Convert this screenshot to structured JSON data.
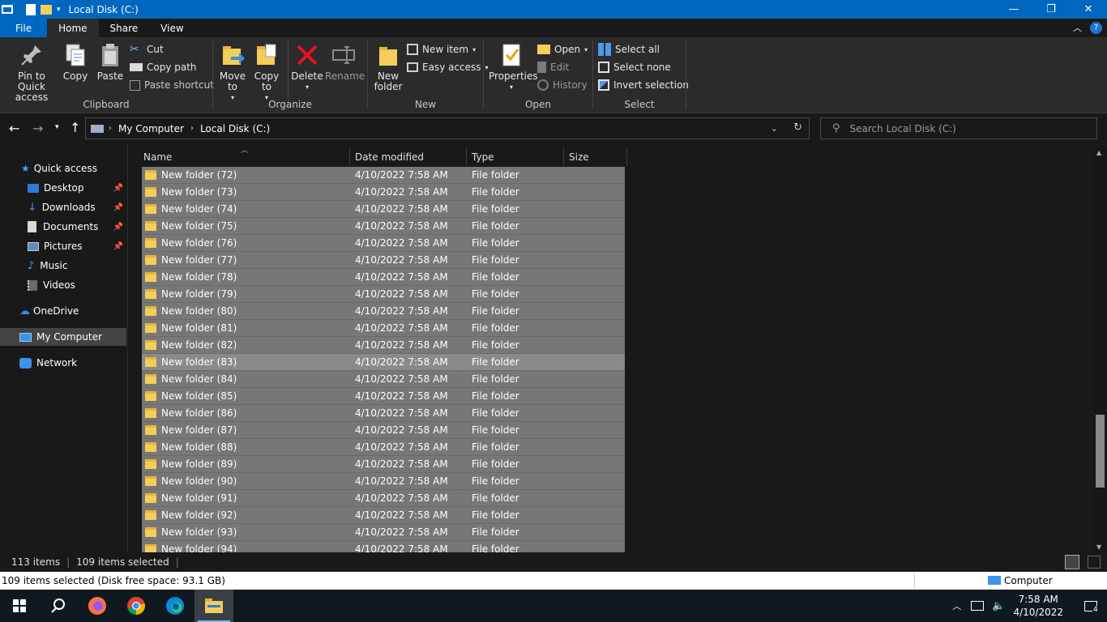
{
  "window": {
    "title": "Local Disk (C:)"
  },
  "tabs": {
    "file": "File",
    "home": "Home",
    "share": "Share",
    "view": "View"
  },
  "ribbon": {
    "clipboard": {
      "label": "Clipboard",
      "pin": "Pin to Quick access",
      "copy": "Copy",
      "paste": "Paste",
      "cut": "Cut",
      "copy_path": "Copy path",
      "paste_shortcut": "Paste shortcut"
    },
    "organize": {
      "label": "Organize",
      "move_to": "Move to",
      "copy_to": "Copy to",
      "delete": "Delete",
      "rename": "Rename"
    },
    "new": {
      "label": "New",
      "new_folder": "New folder",
      "new_item": "New item",
      "easy_access": "Easy access"
    },
    "open": {
      "label": "Open",
      "properties": "Properties",
      "open": "Open",
      "edit": "Edit",
      "history": "History"
    },
    "select": {
      "label": "Select",
      "select_all": "Select all",
      "select_none": "Select none",
      "invert": "Invert selection"
    }
  },
  "address": {
    "crumbs": [
      "My Computer",
      "Local Disk (C:)"
    ],
    "search_placeholder": "Search Local Disk (C:)"
  },
  "nav": {
    "quick_access": "Quick access",
    "desktop": "Desktop",
    "downloads": "Downloads",
    "documents": "Documents",
    "pictures": "Pictures",
    "music": "Music",
    "videos": "Videos",
    "onedrive": "OneDrive",
    "my_computer": "My Computer",
    "network": "Network"
  },
  "columns": {
    "name": "Name",
    "date": "Date modified",
    "type": "Type",
    "size": "Size"
  },
  "rows": [
    {
      "name": "New folder (72)",
      "date": "4/10/2022 7:58 AM",
      "type": "File folder"
    },
    {
      "name": "New folder (73)",
      "date": "4/10/2022 7:58 AM",
      "type": "File folder"
    },
    {
      "name": "New folder (74)",
      "date": "4/10/2022 7:58 AM",
      "type": "File folder"
    },
    {
      "name": "New folder (75)",
      "date": "4/10/2022 7:58 AM",
      "type": "File folder"
    },
    {
      "name": "New folder (76)",
      "date": "4/10/2022 7:58 AM",
      "type": "File folder"
    },
    {
      "name": "New folder (77)",
      "date": "4/10/2022 7:58 AM",
      "type": "File folder"
    },
    {
      "name": "New folder (78)",
      "date": "4/10/2022 7:58 AM",
      "type": "File folder"
    },
    {
      "name": "New folder (79)",
      "date": "4/10/2022 7:58 AM",
      "type": "File folder"
    },
    {
      "name": "New folder (80)",
      "date": "4/10/2022 7:58 AM",
      "type": "File folder"
    },
    {
      "name": "New folder (81)",
      "date": "4/10/2022 7:58 AM",
      "type": "File folder"
    },
    {
      "name": "New folder (82)",
      "date": "4/10/2022 7:58 AM",
      "type": "File folder"
    },
    {
      "name": "New folder (83)",
      "date": "4/10/2022 7:58 AM",
      "type": "File folder"
    },
    {
      "name": "New folder (84)",
      "date": "4/10/2022 7:58 AM",
      "type": "File folder"
    },
    {
      "name": "New folder (85)",
      "date": "4/10/2022 7:58 AM",
      "type": "File folder"
    },
    {
      "name": "New folder (86)",
      "date": "4/10/2022 7:58 AM",
      "type": "File folder"
    },
    {
      "name": "New folder (87)",
      "date": "4/10/2022 7:58 AM",
      "type": "File folder"
    },
    {
      "name": "New folder (88)",
      "date": "4/10/2022 7:58 AM",
      "type": "File folder"
    },
    {
      "name": "New folder (89)",
      "date": "4/10/2022 7:58 AM",
      "type": "File folder"
    },
    {
      "name": "New folder (90)",
      "date": "4/10/2022 7:58 AM",
      "type": "File folder"
    },
    {
      "name": "New folder (91)",
      "date": "4/10/2022 7:58 AM",
      "type": "File folder"
    },
    {
      "name": "New folder (92)",
      "date": "4/10/2022 7:58 AM",
      "type": "File folder"
    },
    {
      "name": "New folder (93)",
      "date": "4/10/2022 7:58 AM",
      "type": "File folder"
    },
    {
      "name": "New folder (94)",
      "date": "4/10/2022 7:58 AM",
      "type": "File folder"
    }
  ],
  "focused_row": "New folder (83)",
  "status": {
    "items": "113 items",
    "selected": "109 items selected"
  },
  "details": {
    "text": "109 items selected (Disk free space: 93.1 GB)",
    "computer": "Computer"
  },
  "taskbar": {
    "time": "7:58 AM",
    "date": "4/10/2022",
    "notifications": "4"
  },
  "colors": {
    "titlebar": "#0067c0",
    "ribbon": "#2b2b2b",
    "background": "#191919",
    "selected_row": "#777777",
    "folder": "#f3ce5b"
  }
}
